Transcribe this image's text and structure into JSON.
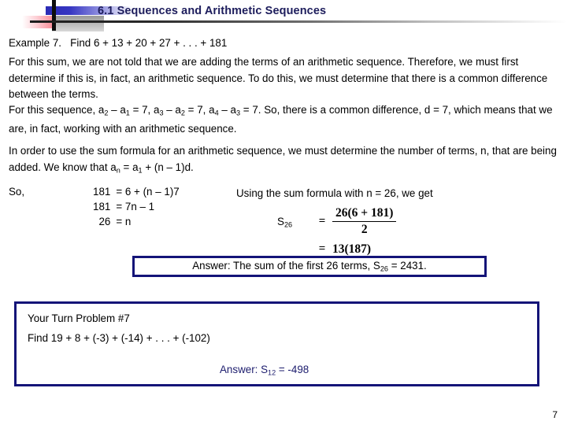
{
  "slide": {
    "title": "6.1 Sequences and Arithmetic Sequences",
    "page_number": "7"
  },
  "decoration": {
    "blue_bar": "blue-gradient-bar",
    "red_bar": "red-gradient-bar",
    "gray_bar": "gray-gradient-bar",
    "horizontal_rule": "header-gradient-rule",
    "vertical_bar": "header-vertical-bar",
    "colors": {
      "blue": "#2b2bb5",
      "red": "#f23b4f",
      "gray": "#b5b5b5",
      "title": "#1d1d5c",
      "box_border": "#141478",
      "answer_text": "#1d1d6e"
    }
  },
  "example": {
    "label": "Example 7.",
    "problem": "Find 6 + 13 + 20 + 27 + . . . + 181"
  },
  "paragraphs": {
    "p1": "For this sum, we are not told that we are adding the terms of an arithmetic sequence.  Therefore, we must first determine if this is, in fact, an arithmetic sequence.  To do this, we must determine that there is a common difference between the terms.",
    "p2_pre": "For this sequence, ",
    "p2_a2": "a",
    "p2_a2_sub": "2",
    "p2_minus1": " – ",
    "p2_a1": "a",
    "p2_a1_sub": "1",
    "p2_eq1": " = 7,  ",
    "p2_a3": "a",
    "p2_a3_sub": "3",
    "p2_minus2": " – ",
    "p2_a2b": "a",
    "p2_a2b_sub": "2",
    "p2_eq2": " = 7,  ",
    "p2_a4": "a",
    "p2_a4_sub": "4",
    "p2_minus3": " – ",
    "p2_a3b": "a",
    "p2_a3b_sub": "3",
    "p2_tail": " = 7.  So, there is a common difference, d = 7, which means that we are, in fact, working with an arithmetic sequence.",
    "p3_pre": "In order to use the sum formula for an arithmetic sequence, we must determine the number of terms, n, that are being added.  We know that ",
    "p3_an": "a",
    "p3_an_sub": "n",
    "p3_mid": " = ",
    "p3_a1": "a",
    "p3_a1_sub": "1",
    "p3_tail": " + (n – 1)d."
  },
  "work": {
    "so_label": "So,",
    "equations": [
      {
        "lhs": "181",
        "rhs": "= 6 + (n – 1)7"
      },
      {
        "lhs": "181",
        "rhs": "= 7n – 1"
      },
      {
        "lhs": "26",
        "rhs": "=  n"
      }
    ],
    "sum_intro": "Using the sum formula with n = 26, we get",
    "formula": {
      "s_symbol": "S",
      "s_sub": "26",
      "equals": "=",
      "numerator": "26(6 + 181)",
      "denominator": "2",
      "equals2": "=",
      "result": "13(187)"
    }
  },
  "answer_box": {
    "pre": "Answer:  The sum of the first 26 terms, ",
    "s_symbol": "S",
    "s_sub": "26",
    "tail": " = 2431."
  },
  "your_turn": {
    "title": "Your Turn Problem #7",
    "problem": "Find 19 + 8 + (-3) + (-14) + . . . + (-102)",
    "answer_pre": "Answer:  ",
    "answer_s": "S",
    "answer_sub": "12",
    "answer_tail": " =  -498"
  }
}
